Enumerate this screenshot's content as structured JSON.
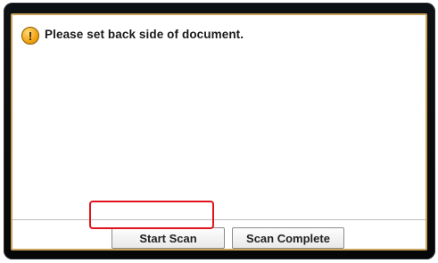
{
  "dialog": {
    "message": "Please set back side of document.",
    "icon": "warning-icon",
    "icon_glyph": "!"
  },
  "buttons": {
    "start_scan": "Start Scan",
    "scan_complete": "Scan Complete"
  },
  "colors": {
    "highlight": "#e0141e",
    "screen_border": "#c8a25a",
    "warning": "#f3a81a"
  }
}
